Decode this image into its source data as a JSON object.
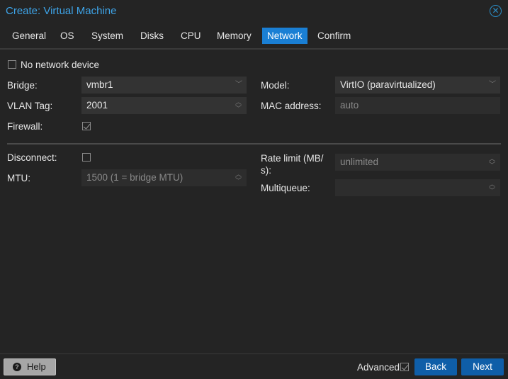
{
  "window": {
    "title": "Create: Virtual Machine",
    "close_icon": "close-circle-icon"
  },
  "tabs": [
    {
      "label": "General"
    },
    {
      "label": "OS"
    },
    {
      "label": "System"
    },
    {
      "label": "Disks"
    },
    {
      "label": "CPU"
    },
    {
      "label": "Memory"
    },
    {
      "label": "Network",
      "active": true
    },
    {
      "label": "Confirm"
    }
  ],
  "form": {
    "no_network_device": {
      "label": "No network device",
      "checked": false
    },
    "bridge": {
      "label": "Bridge:",
      "value": "vmbr1"
    },
    "vlan_tag": {
      "label": "VLAN Tag:",
      "value": "2001"
    },
    "firewall": {
      "label": "Firewall:",
      "checked": true
    },
    "model": {
      "label": "Model:",
      "value": "VirtIO (paravirtualized)"
    },
    "mac_address": {
      "label": "MAC address:",
      "placeholder": "auto"
    },
    "disconnect": {
      "label": "Disconnect:",
      "checked": false
    },
    "mtu": {
      "label": "MTU:",
      "placeholder": "1500 (1 = bridge MTU)"
    },
    "rate_limit": {
      "label_line1": "Rate limit (MB/",
      "label_line2": "s):",
      "placeholder": "unlimited"
    },
    "multiqueue": {
      "label": "Multiqueue:",
      "value": ""
    }
  },
  "footer": {
    "help_label": "Help",
    "advanced_label": "Advanced",
    "advanced_checked": true,
    "back_label": "Back",
    "next_label": "Next"
  },
  "colors": {
    "accent": "#1a7fd4",
    "title": "#3ea4e8",
    "button": "#0f5ea8"
  }
}
